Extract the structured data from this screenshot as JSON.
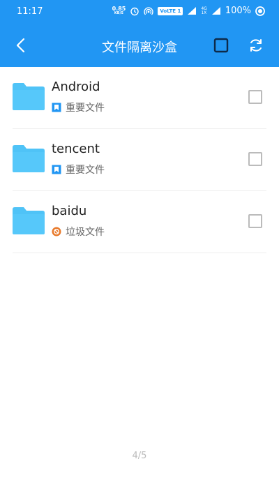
{
  "status": {
    "time": "11:17",
    "net_speed": "0.85",
    "net_unit": "KB/S",
    "volte": "VoLTE 1",
    "dual_top": "4G",
    "dual_bottom": "1X",
    "battery": "100%"
  },
  "toolbar": {
    "title": "文件隔离沙盒"
  },
  "items": [
    {
      "name": "Android",
      "tag": "重要文件",
      "tag_type": "important-file-icon",
      "tag_color": "#2196f3"
    },
    {
      "name": "tencent",
      "tag": "重要文件",
      "tag_type": "important-file-icon",
      "tag_color": "#2196f3"
    },
    {
      "name": "baidu",
      "tag": "垃圾文件",
      "tag_type": "junk-file-icon",
      "tag_color": "#e8792a"
    }
  ],
  "pager": {
    "indicator": "4/5"
  },
  "colors": {
    "primary": "#2196f3",
    "folder": "#4fc3f7",
    "junk": "#e8792a"
  }
}
